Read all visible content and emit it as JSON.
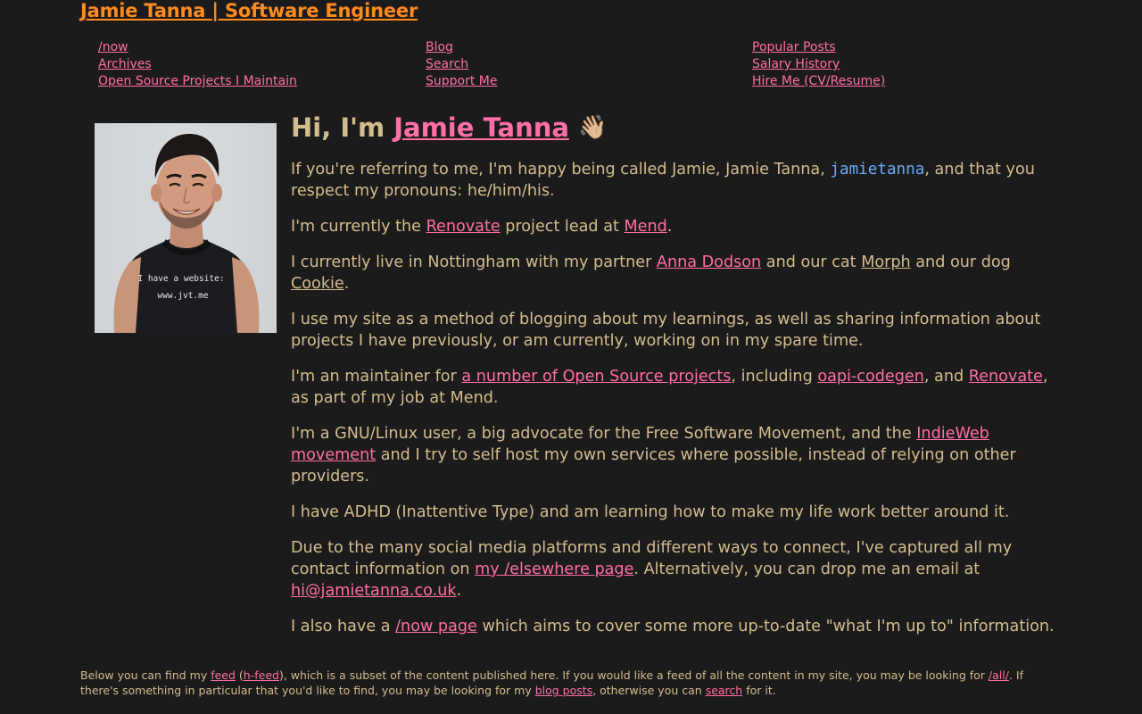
{
  "site": {
    "title": "Jamie Tanna | Software Engineer"
  },
  "nav": {
    "col1": [
      "/now",
      "Archives",
      "Open Source Projects I Maintain"
    ],
    "col2": [
      "Blog",
      "Search",
      "Support Me"
    ],
    "col3": [
      "Popular Posts",
      "Salary History",
      "Hire Me (CV/Resume)"
    ]
  },
  "intro": {
    "greeting_prefix": "Hi, I'm ",
    "name_link": "Jamie Tanna",
    "wave": "👋🏼",
    "p1": {
      "text1": "If you're referring to me, I'm happy being called Jamie, Jamie Tanna, ",
      "handle": "jamietanna",
      "text2": ", and that you respect my pronouns: he/him/his."
    },
    "p2": {
      "text1": "I'm currently the ",
      "link1": "Renovate",
      "text2": " project lead at ",
      "link2": "Mend",
      "text3": "."
    },
    "p3": {
      "text1": "I currently live in Nottingham with my partner ",
      "link1": "Anna Dodson",
      "text2": " and our cat ",
      "link2": "Morph",
      "text3": " and our dog ",
      "link3": "Cookie",
      "text4": "."
    },
    "p4": {
      "text1": "I use my site as a method of blogging about my learnings, as well as sharing information about projects I have previously, or am currently, working on in my spare time."
    },
    "p5": {
      "text1": "I'm an maintainer for ",
      "link1": "a number of Open Source projects",
      "text2": ", including ",
      "link2": "oapi-codegen",
      "text3": ", and ",
      "link3": "Renovate",
      "text4": ", as part of my job at Mend."
    },
    "p6": {
      "text1": "I'm a GNU/Linux user, a big advocate for the Free Software Movement, and the ",
      "link1": "IndieWeb movement",
      "text2": " and I try to self host my own services where possible, instead of relying on other providers."
    },
    "p7": {
      "text1": "I have ADHD (Inattentive Type) and am learning how to make my life work better around it."
    },
    "p8": {
      "text1": "Due to the many social media platforms and different ways to connect, I've captured all my contact information on ",
      "link1": "my /elsewhere page",
      "text2": ". Alternatively, you can drop me an email at ",
      "link2": "hi@jamietanna.co.uk",
      "text3": "."
    },
    "p9": {
      "text1": "I also have a ",
      "link1": "/now page",
      "text2": " which aims to cover some more up-to-date \"what I'm up to\" information."
    }
  },
  "avatar": {
    "shirt_line1": "I have a website:",
    "shirt_line2": "www.jvt.me"
  },
  "footer": {
    "t1": "Below you can find my ",
    "l1": "feed",
    "t2": " (",
    "l2": "h-feed",
    "t3": "), which is a subset of the content published here. If you would like a feed of all the content in my site, you may be looking for ",
    "l3": "/all/",
    "t4": ". If there's something in particular that you'd like to find, you may be looking for my ",
    "l4": "blog posts",
    "t5": ", otherwise you can ",
    "l5": "search",
    "t6": " for it."
  },
  "colors": {
    "background": "#1c1b1b",
    "title": "#ff8a1f",
    "link": "#ff6ea7",
    "text": "#d2bd8f",
    "mono": "#6aaaf5"
  }
}
